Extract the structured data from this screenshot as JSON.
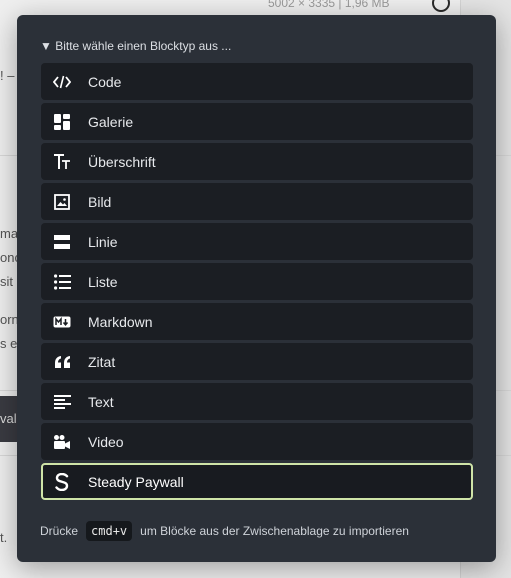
{
  "background": {
    "top_info": "5002 × 3335 | 1,96 MB",
    "fragments": [
      "! –",
      "ma",
      "onc",
      "sit",
      "orn",
      "s e",
      "val",
      "t."
    ]
  },
  "modal": {
    "header": "▼ Bitte wähle einen Blocktyp aus ...",
    "items": [
      {
        "label": "Code",
        "icon": "code-icon"
      },
      {
        "label": "Galerie",
        "icon": "gallery-icon"
      },
      {
        "label": "Überschrift",
        "icon": "heading-icon"
      },
      {
        "label": "Bild",
        "icon": "image-icon"
      },
      {
        "label": "Linie",
        "icon": "line-icon"
      },
      {
        "label": "Liste",
        "icon": "list-icon"
      },
      {
        "label": "Markdown",
        "icon": "markdown-icon"
      },
      {
        "label": "Zitat",
        "icon": "quote-icon"
      },
      {
        "label": "Text",
        "icon": "text-icon"
      },
      {
        "label": "Video",
        "icon": "video-icon"
      },
      {
        "label": "Steady Paywall",
        "icon": "steady-s-icon"
      }
    ],
    "selected_index": 10,
    "footer": {
      "prefix": "Drücke",
      "shortcut": "cmd+v",
      "suffix": "um Blöcke aus der Zwischenablage zu importieren"
    },
    "colors": {
      "modal_bg": "#2b3038",
      "item_bg": "#1b1e23",
      "selected_border": "#cfe4a8"
    }
  }
}
